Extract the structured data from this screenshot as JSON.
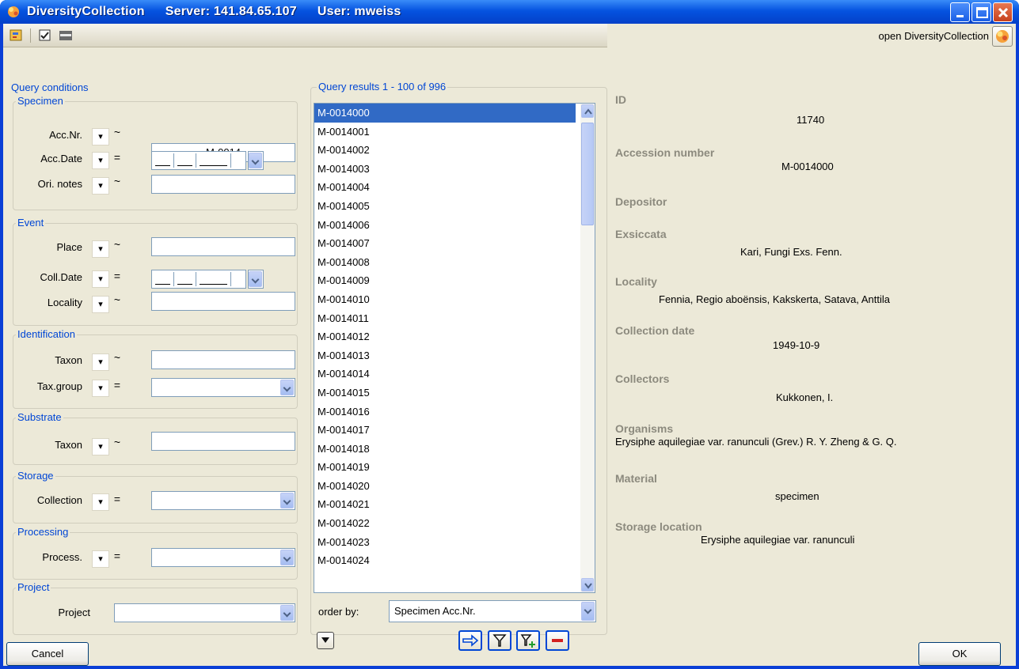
{
  "window": {
    "app": "DiversityCollection",
    "server": "Server: 141.84.65.107",
    "user": "User: mweiss"
  },
  "open_dc": "open DiversityCollection",
  "query": {
    "legend": "Query conditions",
    "specimen": {
      "legend": "Specimen",
      "acc_nr": "Acc.Nr.",
      "acc_nr_value": "M-0014",
      "acc_date": "Acc.Date",
      "ori_notes": "Ori. notes"
    },
    "event": {
      "legend": "Event",
      "place": "Place",
      "coll_date": "Coll.Date",
      "locality": "Locality"
    },
    "identification": {
      "legend": "Identification",
      "taxon": "Taxon",
      "tax_group": "Tax.group"
    },
    "substrate": {
      "legend": "Substrate",
      "taxon": "Taxon"
    },
    "storage": {
      "legend": "Storage",
      "collection": "Collection"
    },
    "processing": {
      "legend": "Processing",
      "process": "Process."
    },
    "project": {
      "legend": "Project",
      "project": "Project"
    },
    "op_tilde": "~",
    "op_eq": "=",
    "op_dropdown": "▾"
  },
  "results": {
    "legend": "Query results   1 - 100 of 996",
    "items": [
      "M-0014000",
      "M-0014001",
      "M-0014002",
      "M-0014003",
      "M-0014004",
      "M-0014005",
      "M-0014006",
      "M-0014007",
      "M-0014008",
      "M-0014009",
      "M-0014010",
      "M-0014011",
      "M-0014012",
      "M-0014013",
      "M-0014014",
      "M-0014015",
      "M-0014016",
      "M-0014017",
      "M-0014018",
      "M-0014019",
      "M-0014020",
      "M-0014021",
      "M-0014022",
      "M-0014023",
      "M-0014024"
    ],
    "selected": "M-0014000",
    "order_by_label": "order by:",
    "order_by_value": "Specimen Acc.Nr."
  },
  "details": {
    "id_label": "ID",
    "id_value": "11740",
    "acc_label": "Accession number",
    "acc_value": "M-0014000",
    "depositor_label": "Depositor",
    "exsiccata_label": "Exsiccata",
    "exsiccata_value": "Kari, Fungi Exs. Fenn.",
    "locality_label": "Locality",
    "locality_value": "Fennia, Regio aboënsis, Kakskerta, Satava, Anttila",
    "coll_date_label": "Collection date",
    "coll_date_value": "1949-10-9",
    "collectors_label": "Collectors",
    "collectors_value": "Kukkonen, I.",
    "organisms_label": "Organisms",
    "organisms_value": "Erysiphe aquilegiae var. ranunculi (Grev.) R. Y. Zheng & G. Q.",
    "material_label": "Material",
    "material_value": "specimen",
    "storage_label": "Storage location",
    "storage_value": "Erysiphe aquilegiae var. ranunculi"
  },
  "buttons": {
    "cancel": "Cancel",
    "ok": "OK"
  }
}
